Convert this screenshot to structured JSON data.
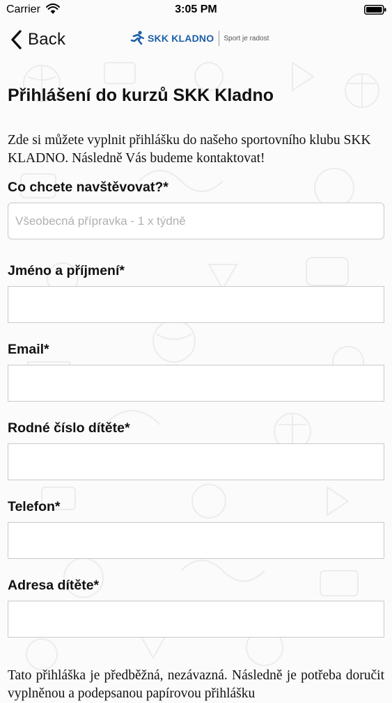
{
  "status_bar": {
    "carrier": "Carrier",
    "time": "3:05 PM"
  },
  "nav": {
    "back_label": "Back",
    "logo_name": "SKK KLADNO",
    "logo_tagline": "Sport je radost",
    "brand_color": "#1d5fa8"
  },
  "page": {
    "title": "Přihlášení do kurzů SKK Kladno",
    "intro": "Zde si můžete vyplnit přihlášku do našeho sportovního klubu SKK KLADNO. Následně Vás budeme kontaktovat!",
    "disclaimer": "Tato přihláška je předběžná, nezávazná. Následně je potřeba doručit vyplněnou a podepsanou papírovou přihlášku"
  },
  "form": {
    "course": {
      "label": "Co chcete navštěvovat?*",
      "placeholder": "Všeobecná přípravka - 1 x týdně",
      "value": ""
    },
    "name": {
      "label": "Jméno a příjmení*",
      "value": ""
    },
    "email": {
      "label": "Email*",
      "value": ""
    },
    "birth_number": {
      "label": "Rodné číslo dítěte*",
      "value": ""
    },
    "phone": {
      "label": "Telefon*",
      "value": ""
    },
    "address": {
      "label": "Adresa dítěte*",
      "value": ""
    }
  }
}
